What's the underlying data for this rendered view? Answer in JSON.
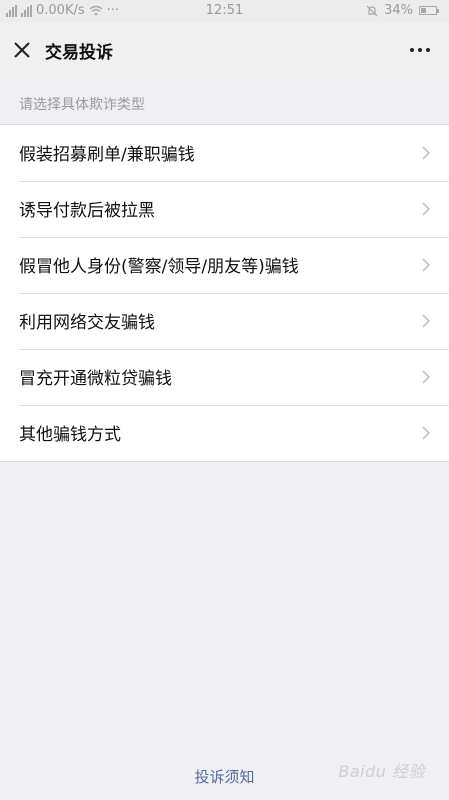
{
  "status_bar": {
    "network_speed": "0.00K/s",
    "overflow": "···",
    "time": "12:51",
    "battery_percent": "34%",
    "battery_level": 0.34
  },
  "nav": {
    "title": "交易投诉"
  },
  "section_header": "请选择具体欺诈类型",
  "options": [
    {
      "label": "假装招募刷单/兼职骗钱"
    },
    {
      "label": "诱导付款后被拉黑"
    },
    {
      "label": "假冒他人身份(警察/领导/朋友等)骗钱"
    },
    {
      "label": "利用网络交友骗钱"
    },
    {
      "label": "冒充开通微粒贷骗钱"
    },
    {
      "label": "其他骗钱方式"
    }
  ],
  "footer_link": "投诉须知",
  "watermark": "Baidu 经验",
  "colors": {
    "link": "#576b95",
    "background": "#efeff4"
  }
}
